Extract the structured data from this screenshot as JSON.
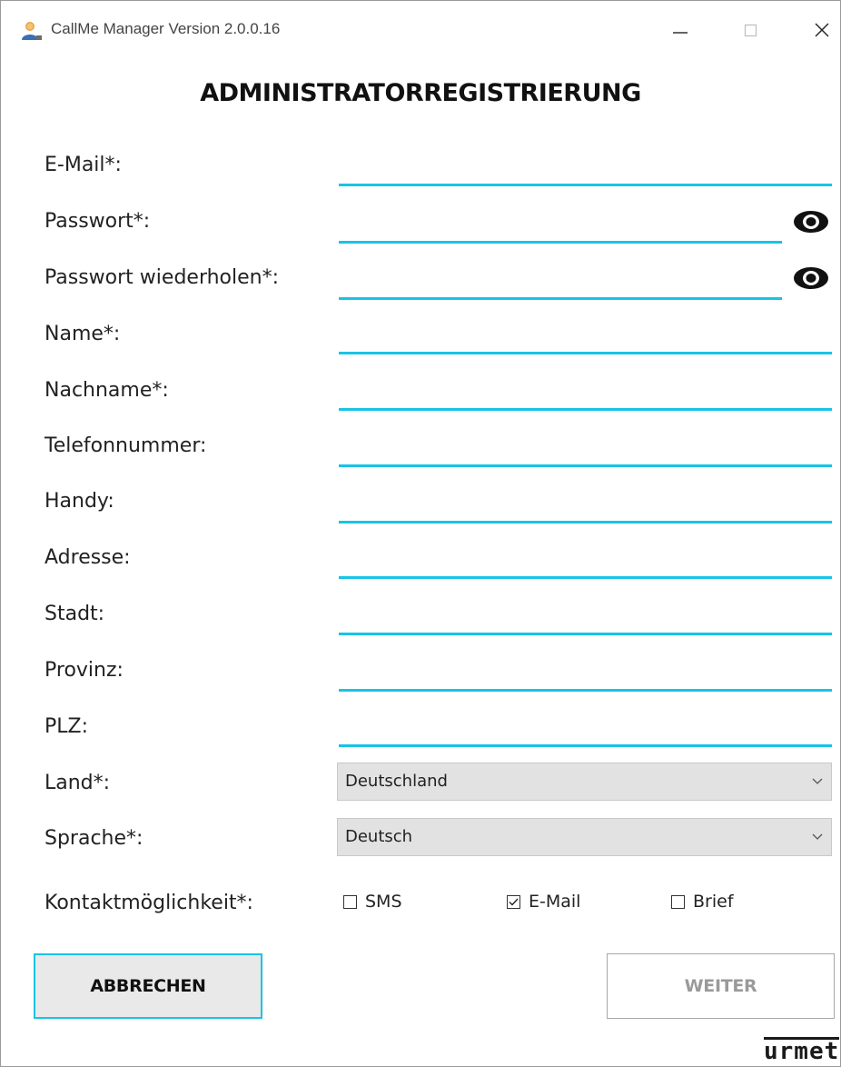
{
  "window": {
    "title": "CallMe Manager Version 2.0.0.16"
  },
  "heading": "ADMINISTRATORREGISTRIERUNG",
  "fields": {
    "email": {
      "label": "E-Mail*:",
      "value": ""
    },
    "password": {
      "label": "Passwort*:",
      "value": ""
    },
    "password_repeat": {
      "label": "Passwort wiederholen*:",
      "value": ""
    },
    "first_name": {
      "label": "Name*:",
      "value": ""
    },
    "last_name": {
      "label": "Nachname*:",
      "value": ""
    },
    "phone": {
      "label": "Telefonnummer:",
      "value": ""
    },
    "mobile": {
      "label": "Handy:",
      "value": ""
    },
    "address": {
      "label": "Adresse:",
      "value": ""
    },
    "city": {
      "label": "Stadt:",
      "value": ""
    },
    "province": {
      "label": "Provinz:",
      "value": ""
    },
    "zip": {
      "label": "PLZ:",
      "value": ""
    }
  },
  "selects": {
    "country": {
      "label": "Land*:",
      "value": "Deutschland"
    },
    "language": {
      "label": "Sprache*:",
      "value": "Deutsch"
    }
  },
  "contact": {
    "label": "Kontaktmöglichkeit*:",
    "options": [
      {
        "label": "SMS",
        "checked": false
      },
      {
        "label": "E-Mail",
        "checked": true
      },
      {
        "label": "Brief",
        "checked": false
      }
    ]
  },
  "buttons": {
    "cancel": "ABBRECHEN",
    "next": "WEITER"
  },
  "brand": "urmet",
  "icons": {
    "app": "user-icon",
    "minimize": "minimize-icon",
    "maximize": "maximize-icon",
    "close": "close-icon",
    "show_password": "eye-icon",
    "dropdown": "chevron-down-icon"
  },
  "colors": {
    "accent": "#19c3e6",
    "select_bg": "#e2e2e2",
    "disabled_text": "#9a9a9a"
  }
}
